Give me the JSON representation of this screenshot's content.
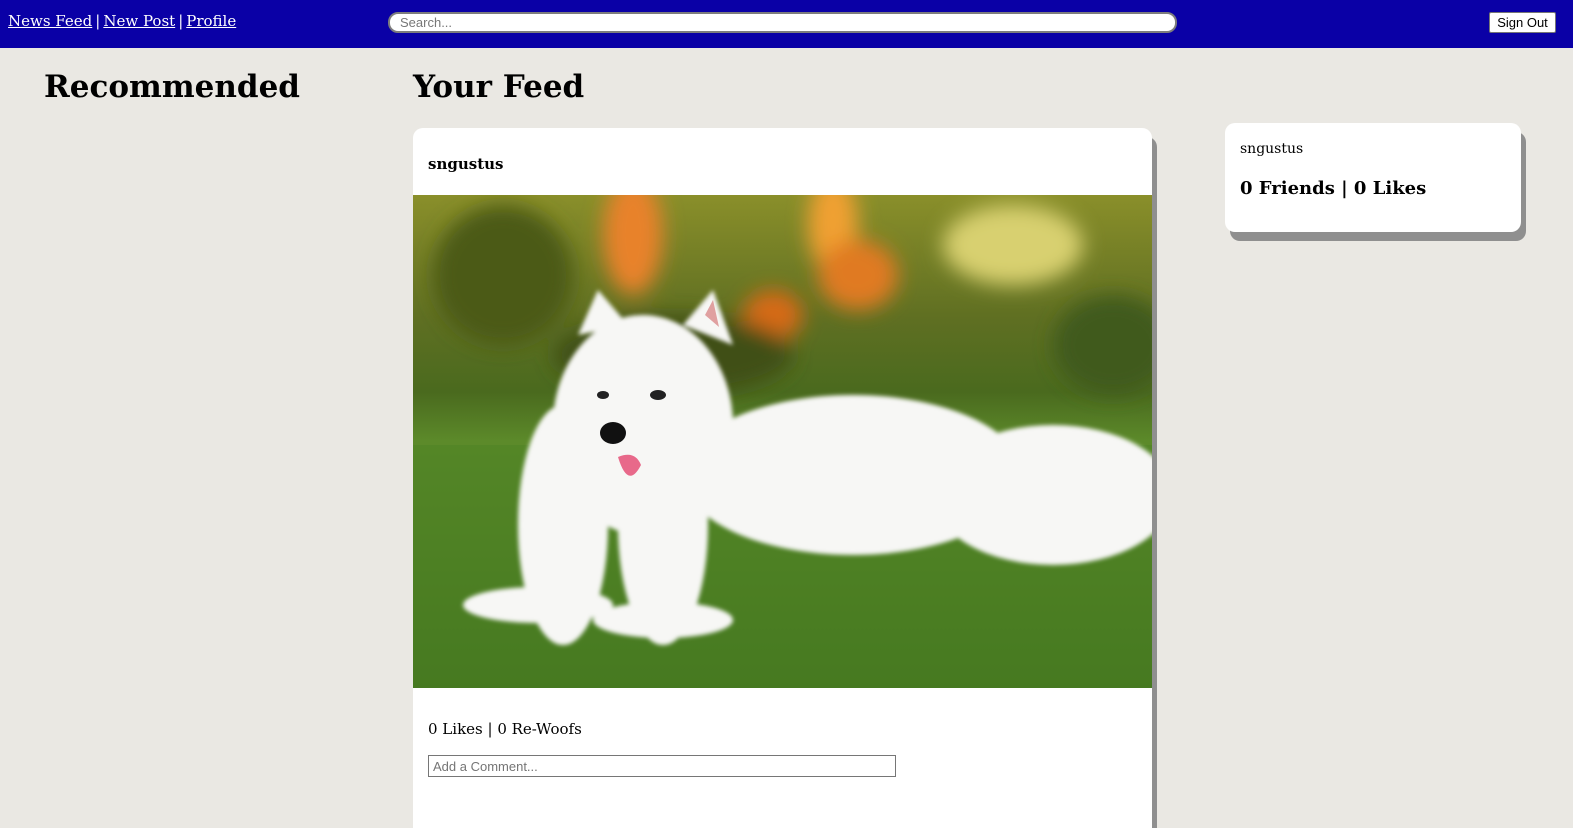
{
  "nav": {
    "links": [
      "News Feed",
      "New Post",
      "Profile"
    ],
    "separator": "|"
  },
  "search": {
    "placeholder": "Search..."
  },
  "signout_label": "Sign Out",
  "recommended": {
    "heading": "Recommended"
  },
  "feed": {
    "heading": "Your Feed",
    "post": {
      "username": "sngustus",
      "image_icon": "white-fluffy-dog-photo",
      "stats": "0 Likes | 0 Re-Woofs",
      "comment_placeholder": "Add a Comment..."
    }
  },
  "profile_card": {
    "username": "sngustus",
    "stats": "0 Friends | 0 Likes"
  },
  "colors": {
    "topbar": "#0a00a6",
    "background": "#eae8e3",
    "card": "#ffffff",
    "shadow": "#8f8f8f"
  }
}
